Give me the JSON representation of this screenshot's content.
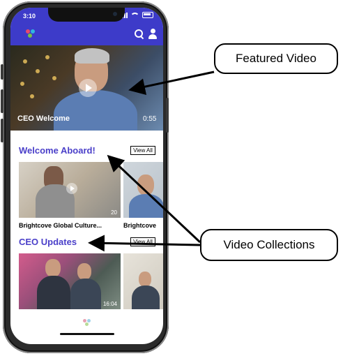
{
  "status_bar": {
    "time": "3:10"
  },
  "header": {
    "logo_icon": "brightcove-logo-icon",
    "search_icon": "search-icon",
    "profile_icon": "profile-icon"
  },
  "featured": {
    "title": "CEO Welcome",
    "duration": "0:55"
  },
  "sections": [
    {
      "title": "Welcome Aboard!",
      "view_all": "View All",
      "items": [
        {
          "label": "Brightcove Global Culture...",
          "duration": "20"
        },
        {
          "label": "Brightcove"
        }
      ]
    },
    {
      "title": "CEO Updates",
      "view_all": "View All",
      "items": [
        {
          "label": "",
          "duration": "16:04"
        },
        {
          "label": ""
        }
      ]
    }
  ],
  "annotations": {
    "featured_video": "Featured Video",
    "video_collections": "Video Collections"
  },
  "colors": {
    "brand": "#3d3bc9",
    "section_title": "#4a3fc9"
  }
}
